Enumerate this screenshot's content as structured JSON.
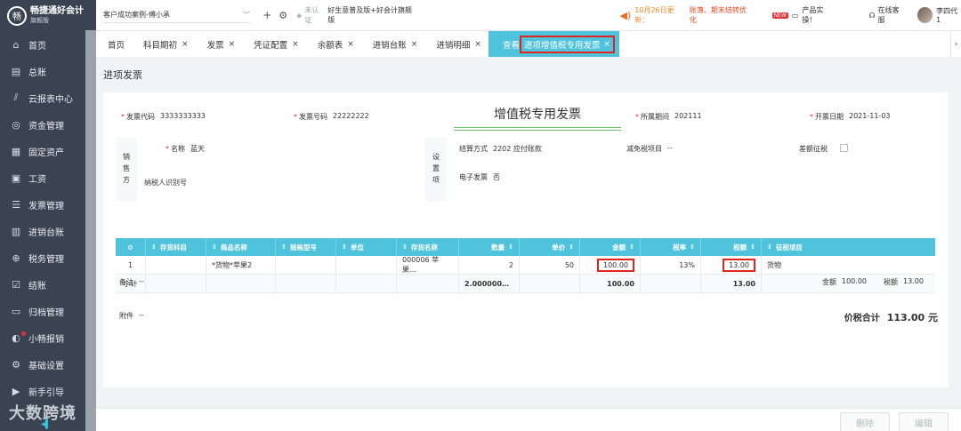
{
  "app": {
    "logo_glyph": "畅",
    "name": "畅捷通好会计",
    "edition": "旗舰版"
  },
  "sidebar": {
    "items": [
      {
        "label": "首页",
        "icon": "home-icon",
        "glyph": "⌂"
      },
      {
        "label": "总账",
        "icon": "ledger-icon",
        "glyph": "▤"
      },
      {
        "label": "云报表中心",
        "icon": "chart-icon",
        "glyph": "⫽"
      },
      {
        "label": "资金管理",
        "icon": "money-icon",
        "glyph": "◎"
      },
      {
        "label": "固定资产",
        "icon": "asset-icon",
        "glyph": "▦"
      },
      {
        "label": "工资",
        "icon": "salary-icon",
        "glyph": "▣"
      },
      {
        "label": "发票管理",
        "icon": "invoice-icon",
        "glyph": "☰"
      },
      {
        "label": "进销台账",
        "icon": "purchase-sales-icon",
        "glyph": "▥"
      },
      {
        "label": "税务管理",
        "icon": "tax-icon",
        "glyph": "⊕"
      },
      {
        "label": "结账",
        "icon": "close-books-icon",
        "glyph": "☑"
      },
      {
        "label": "归档管理",
        "icon": "archive-icon",
        "glyph": "▭"
      },
      {
        "label": "小畅报销",
        "icon": "reimburse-icon",
        "glyph": "◐"
      },
      {
        "label": "基础设置",
        "icon": "settings-icon",
        "glyph": "⚙"
      },
      {
        "label": "新手引导",
        "icon": "guide-icon",
        "glyph": "▶"
      }
    ],
    "watermark": "大数跨境",
    "collapse_glyph": "◂▍"
  },
  "topbar": {
    "client": "客户成功案例-傅小承",
    "add_glyph": "+",
    "settings_glyph": "⚙",
    "cert_status": "未认证",
    "product": "好生意普及版+好会计旗舰版",
    "notice_date": "10月26日更新：",
    "notice_text": "账簿、期末结转优化",
    "new_badge": "NEW",
    "product_practice": "产品实操！",
    "service": "在线客服",
    "user": "李四代1"
  },
  "tabs": [
    {
      "label": "首页",
      "closable": false
    },
    {
      "label": "科目期初",
      "closable": true
    },
    {
      "label": "发票",
      "closable": true
    },
    {
      "label": "凭证配置",
      "closable": true
    },
    {
      "label": "余额表",
      "closable": true
    },
    {
      "label": "进销台账",
      "closable": true
    },
    {
      "label": "进销明细",
      "closable": true
    }
  ],
  "active_tab": {
    "prefix": "查看",
    "label": "进项增值税专用发票"
  },
  "page": {
    "title": "进项发票"
  },
  "invoice": {
    "title": "增值税专用发票",
    "code_label": "发票代码",
    "code": "3333333333",
    "number_label": "发票号码",
    "number": "22222222",
    "period_label": "所属期间",
    "period": "202111",
    "date_label": "开票日期",
    "date": "2021-11-03",
    "seller_label": "销售方",
    "settings_label": "设置项",
    "name_label": "名称",
    "name": "蓝天",
    "taxid_label": "纳税人识别号",
    "settle_label": "结算方式",
    "settle": "2202 应付账款",
    "exempt_label": "减免税项目",
    "exempt": "--",
    "diff_label": "差额征税",
    "einvoice_label": "电子发票",
    "einvoice": "否"
  },
  "table": {
    "headers": [
      "存货科目",
      "商品名称",
      "规格型号",
      "单位",
      "存货名称",
      "数量",
      "单价",
      "金额",
      "税率",
      "税额",
      "征税项目"
    ],
    "rows": [
      {
        "no": "1",
        "stock_account": "",
        "product": "*货物*苹果2",
        "spec": "",
        "unit": "",
        "stock_name": "000006 苹果…",
        "qty": "2",
        "price": "50",
        "amount": "100.00",
        "rate": "13%",
        "tax": "13.00",
        "tax_item": "货物"
      }
    ],
    "subtotal": {
      "label": "小计",
      "qty": "2.000000…",
      "amount": "100.00",
      "tax": "13.00"
    }
  },
  "footer": {
    "remark_label": "备注",
    "remark": "--",
    "amount_label": "金额",
    "amount": "100.00",
    "tax_label": "税额",
    "tax": "13.00",
    "attach_label": "附件",
    "attach": "--",
    "total_label": "价税合计",
    "total": "113.00 元"
  },
  "actions": {
    "delete": "删除",
    "edit": "编辑"
  }
}
